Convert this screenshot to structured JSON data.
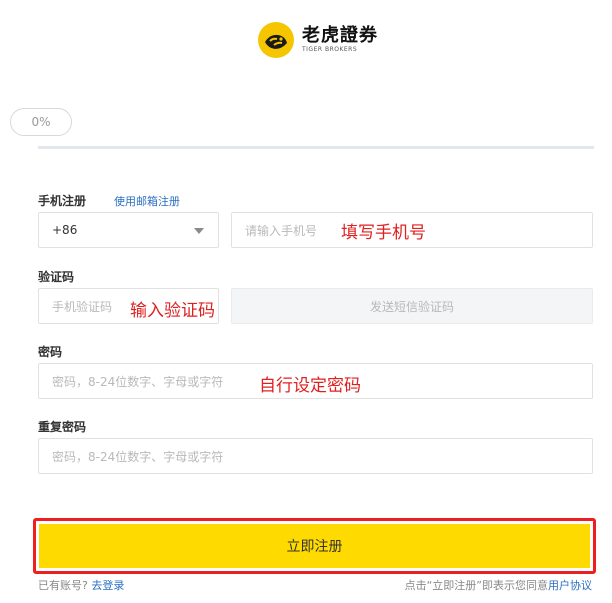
{
  "brand": {
    "name_cn": "老虎證券",
    "name_en": "TIGER BROKERS"
  },
  "progress": {
    "label": "0%",
    "value": 0
  },
  "phone": {
    "label": "手机注册",
    "switch_link": "使用邮箱注册",
    "country_code": "+86",
    "placeholder": "请输入手机号",
    "annotation": "填写手机号"
  },
  "code": {
    "label": "验证码",
    "placeholder": "手机验证码",
    "annotation": "输入验证码",
    "send_button": "发送短信验证码"
  },
  "password": {
    "label": "密码",
    "placeholder": "密码，8-24位数字、字母或字符",
    "annotation": "自行设定密码"
  },
  "repeat_password": {
    "label": "重复密码",
    "placeholder": "密码，8-24位数字、字母或字符"
  },
  "submit": {
    "label": "立即注册"
  },
  "footer": {
    "have_account": "已有账号?",
    "login_link": "去登录",
    "agreement_text": "点击“立即注册”即表示您同意",
    "agreement_link": "用户协议"
  },
  "colors": {
    "accent": "#ffda00",
    "link": "#2b6fc1",
    "annotation": "#e02020",
    "highlight_frame": "#ef1f1f"
  }
}
